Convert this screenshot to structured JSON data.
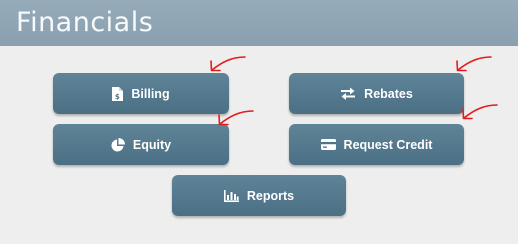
{
  "header": {
    "title": "Financials"
  },
  "tiles": {
    "billing": {
      "label": "Billing",
      "icon": "invoice-icon"
    },
    "rebates": {
      "label": "Rebates",
      "icon": "exchange-arrows-icon"
    },
    "equity": {
      "label": "Equity",
      "icon": "pie-chart-icon"
    },
    "request_credit": {
      "label": "Request Credit",
      "icon": "credit-card-icon"
    },
    "reports": {
      "label": "Reports",
      "icon": "bar-chart-icon"
    }
  },
  "colors": {
    "header_bg": "#8ea3b2",
    "tile_bg": "#557a8e",
    "annotation_arrow": "#e11d1d"
  }
}
